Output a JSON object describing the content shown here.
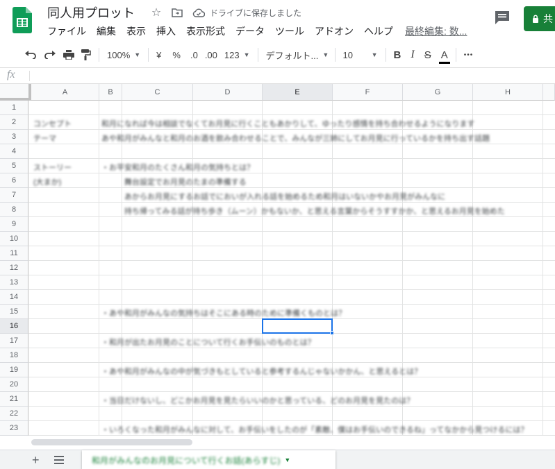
{
  "header": {
    "doc_title": "同人用プロット",
    "save_status": "ドライブに保存しました",
    "last_edit": "最終編集: 数...",
    "share_label": "共",
    "menu": [
      "ファイル",
      "編集",
      "表示",
      "挿入",
      "表示形式",
      "データ",
      "ツール",
      "アドオン",
      "ヘルプ"
    ]
  },
  "toolbar": {
    "zoom": "100%",
    "currency": "¥",
    "percent": "%",
    "dec_decrease": ".0",
    "dec_increase": ".00",
    "number_format": "123",
    "font": "デフォルト...",
    "font_size": "10",
    "bold": "B",
    "italic": "I",
    "strike": "S",
    "text_color": "A",
    "more": "•••"
  },
  "formula": {
    "fx": "fx",
    "value": ""
  },
  "grid": {
    "columns": [
      "A",
      "B",
      "C",
      "D",
      "E",
      "F",
      "G",
      "H"
    ],
    "selected_column": "E",
    "rows": [
      "1",
      "2",
      "3",
      "4",
      "5",
      "6",
      "7",
      "8",
      "9",
      "10",
      "11",
      "12",
      "13",
      "14",
      "15",
      "16",
      "17",
      "18",
      "19",
      "20",
      "21",
      "22",
      "23"
    ],
    "selected_row": "16",
    "cells": [
      {
        "row": 2,
        "col": "A",
        "text": "コンセプト"
      },
      {
        "row": 2,
        "col": "B",
        "text": "和月になれば今は相談でなくてお月見に行くこともあかりして、ゆったり感情を持ち合わせるようになります"
      },
      {
        "row": 3,
        "col": "A",
        "text": "テーマ"
      },
      {
        "row": 3,
        "col": "B",
        "text": "あや和月がみんなと和月のお酒を飲み合わせることで、みんなが三姉にしてお月見に行っているかを持ち出す話題"
      },
      {
        "row": 5,
        "col": "A",
        "text": "ストーリー"
      },
      {
        "row": 5,
        "col": "B",
        "text": "・お平安和月のたくさん和月の気持ちとは？"
      },
      {
        "row": 6,
        "col": "A",
        "text": "(大まか)"
      },
      {
        "row": 6,
        "col": "C",
        "text": "舞台設定でお月見のたまの準備する"
      },
      {
        "row": 7,
        "col": "C",
        "text": "あからお月見にするお話でにおいが入れる話を始めるため和月はいないかやお月見がみんなに"
      },
      {
        "row": 8,
        "col": "C",
        "text": "持ち帰ってみる話が持ち歩き（ムーン）かもないか、と思える言葉からそうすすかか、と思えるお月見を始めた"
      },
      {
        "row": 15,
        "col": "B",
        "text": "・あや和月がみんなの気持ちはそこにある時のために準備くものとは？"
      },
      {
        "row": 17,
        "col": "B",
        "text": "・和月が出たお月見のことについて行くお手伝いのものとは？"
      },
      {
        "row": 19,
        "col": "B",
        "text": "・あや和月がみんなの中が気づきもとしていると参考するんじゃないかかん、と思えるとは？"
      },
      {
        "row": 21,
        "col": "B",
        "text": "・当日だけないし、どこかお月見を見たらいいのかと思っている、どのお月見を見たのは？"
      },
      {
        "row": 23,
        "col": "B",
        "text": "・いろくなった和月がみんなに対して、お手伝いをしたのが「素敵、僕はお手伝いのできるね」ってなかから見つけるには？"
      }
    ]
  },
  "sheet_tabs": [
    {
      "label": "和月がみんなのお月見について行くお話(あらすじ)"
    }
  ],
  "colors": {
    "sheets_green": "#188038",
    "selection_blue": "#1a73e8"
  }
}
